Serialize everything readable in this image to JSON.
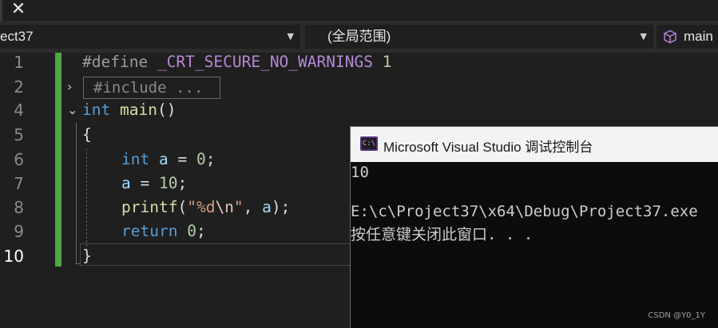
{
  "tab": {
    "close_glyph": "✕"
  },
  "navbar": {
    "project_dropdown": "ect37",
    "scope_dropdown": "(全局范围)",
    "member_dropdown": "main",
    "dropdown_arrow": "▼"
  },
  "editor": {
    "line_numbers": [
      "1",
      "2",
      "4",
      "5",
      "6",
      "7",
      "8",
      "9",
      "10"
    ],
    "active_line": "10",
    "collapsed_include": "#include ...",
    "lines": {
      "l1_directive": "#define",
      "l1_macro": "_CRT_SECURE_NO_WARNINGS",
      "l1_value": "1",
      "l4_type": "int",
      "l4_func": "main",
      "l4_parens": "()",
      "l5": "{",
      "l6_type": "int",
      "l6_var": "a",
      "l6_op": " = ",
      "l6_num": "0",
      "l6_end": ";",
      "l7_var": "a",
      "l7_op": " = ",
      "l7_num": "10",
      "l7_end": ";",
      "l8_func": "printf",
      "l8_open": "(",
      "l8_q1": "\"",
      "l8_fmt": "%d",
      "l8_esc": "\\n",
      "l8_q2": "\"",
      "l8_comma": ", ",
      "l8_arg": "a",
      "l8_close": ");",
      "l9_kw": "return",
      "l9_num": "0",
      "l9_end": ";",
      "l10": "}"
    },
    "colors": {
      "change_bar": "#4ea845",
      "keyword": "#569cd6",
      "function": "#dcdcaa",
      "string": "#d69d85"
    }
  },
  "console": {
    "title": "Microsoft Visual Studio 调试控制台",
    "icon_text": "C:\\",
    "output": [
      "10",
      "",
      "E:\\c\\Project37\\x64\\Debug\\Project37.exe",
      "按任意键关闭此窗口. . ."
    ]
  },
  "watermark": "CSDN @Y0_1Y"
}
